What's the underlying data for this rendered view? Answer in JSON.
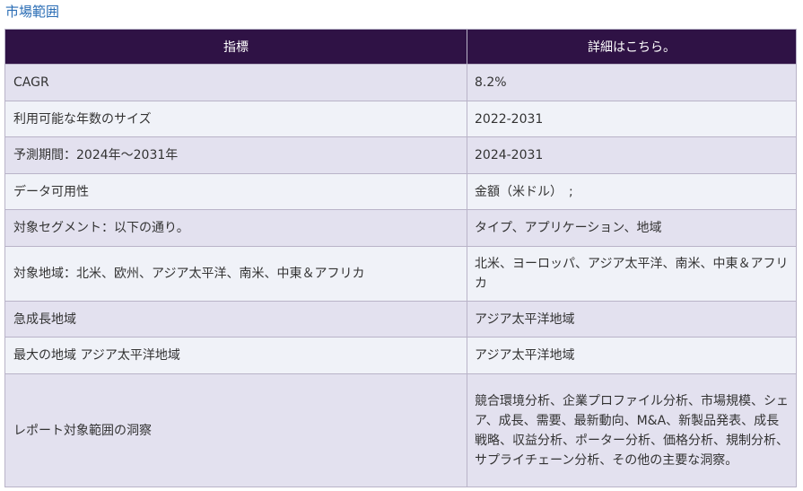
{
  "section_title": "市場範囲",
  "table": {
    "headers": [
      "指標",
      "詳細はこちら。"
    ],
    "rows": [
      {
        "key": "CAGR",
        "value": "8.2%"
      },
      {
        "key": "利用可能な年数のサイズ",
        "value": "2022-2031"
      },
      {
        "key": "予測期間：2024年～2031年",
        "value": "2024-2031"
      },
      {
        "key": "データ可用性",
        "value": "金額（米ドル）　;"
      },
      {
        "key": "対象セグメント：以下の通り。",
        "value": "タイプ、アプリケーション、地域"
      },
      {
        "key": "対象地域：北米、欧州、アジア太平洋、南米、中東＆アフリカ",
        "value": "北米、ヨーロッパ、アジア太平洋、南米、中東＆アフリカ"
      },
      {
        "key": "急成長地域",
        "value": "アジア太平洋地域"
      },
      {
        "key": "最大の地域 アジア太平洋地域",
        "value": "アジア太平洋地域"
      },
      {
        "key": "レポート対象範囲の洞察",
        "value": "競合環境分析、企業プロファイル分析、市場規模、シェア、成長、需要、最新動向、M&A、新製品発表、成長戦略、収益分析、ポーター分析、価格分析、規制分析、サプライチェーン分析、その他の主要な洞察。"
      }
    ]
  }
}
